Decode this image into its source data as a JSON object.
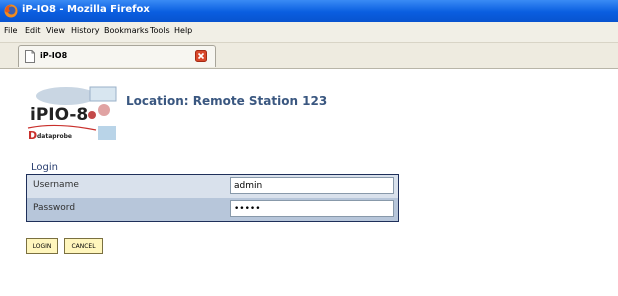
{
  "window": {
    "title": "iP-IO8 - Mozilla Firefox",
    "accent": "#0a5ee0"
  },
  "menu": [
    "File",
    "Edit",
    "View",
    "History",
    "Bookmarks",
    "Tools",
    "Help"
  ],
  "tab": {
    "label": "iP-IO8"
  },
  "logo": {
    "text": "iPIO-8",
    "brand": "dataprobe"
  },
  "location": "Location: Remote Station 123",
  "login": {
    "title": "Login",
    "username_label": "Username",
    "username_value": "admin",
    "password_label": "Password",
    "password_value": "•••••",
    "login_button": "LOGIN",
    "cancel_button": "CANCEL"
  },
  "colors": {
    "panel_border": "#1e2f5a",
    "button_bg": "#fff6bd",
    "heading": "#3a5780"
  }
}
